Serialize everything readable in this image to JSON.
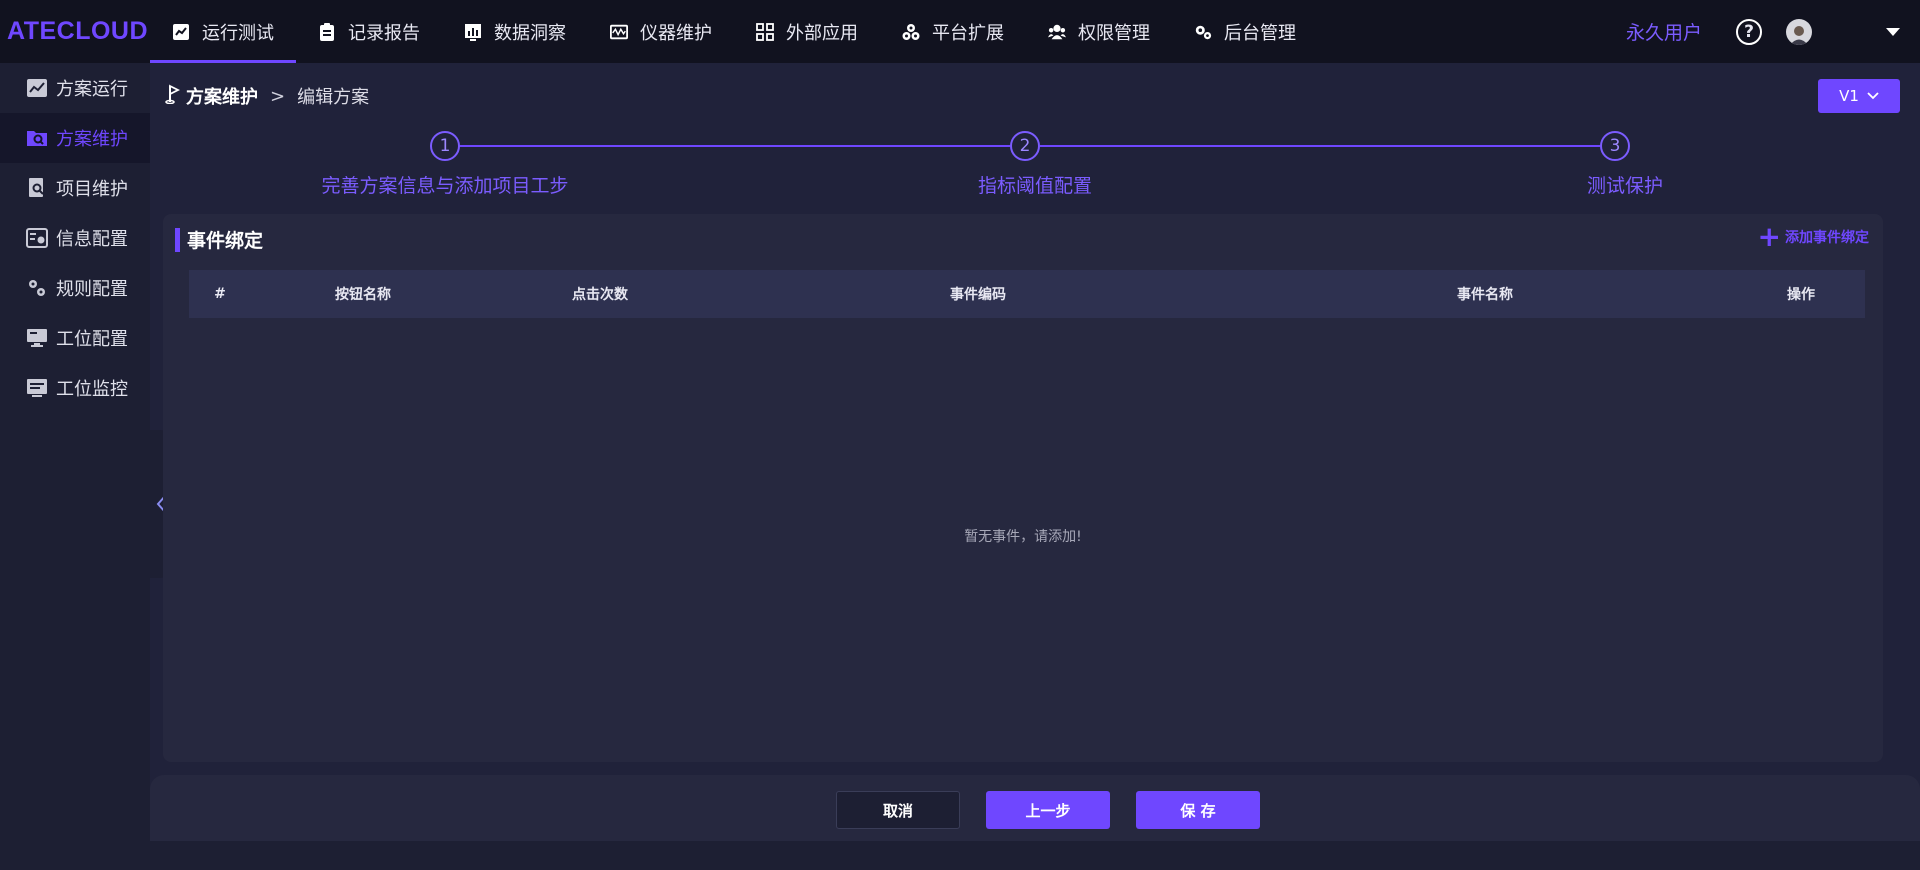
{
  "app": {
    "logo": "ATECLOUD"
  },
  "nav": {
    "items": [
      {
        "label": "运行测试",
        "icon": "chart-line-icon"
      },
      {
        "label": "记录报告",
        "icon": "clipboard-icon"
      },
      {
        "label": "数据洞察",
        "icon": "bar-chart-icon"
      },
      {
        "label": "仪器维护",
        "icon": "waveform-icon"
      },
      {
        "label": "外部应用",
        "icon": "grid-icon"
      },
      {
        "label": "平台扩展",
        "icon": "cubes-icon"
      },
      {
        "label": "权限管理",
        "icon": "users-icon"
      },
      {
        "label": "后台管理",
        "icon": "gears-icon"
      }
    ],
    "active_index": 0
  },
  "header": {
    "user_type": "永久用户",
    "help": "?",
    "username": " "
  },
  "sidebar": {
    "items": [
      {
        "label": "方案运行",
        "icon": "trend-icon"
      },
      {
        "label": "方案维护",
        "icon": "folder-search-icon"
      },
      {
        "label": "项目维护",
        "icon": "doc-search-icon"
      },
      {
        "label": "信息配置",
        "icon": "settings-panel-icon"
      },
      {
        "label": "规则配置",
        "icon": "rules-icon"
      },
      {
        "label": "工位配置",
        "icon": "monitor-icon"
      },
      {
        "label": "工位监控",
        "icon": "list-panel-icon"
      }
    ],
    "active_index": 1
  },
  "breadcrumb": {
    "root": "方案维护",
    "separator": ">",
    "current": "编辑方案"
  },
  "version": {
    "label": "V1"
  },
  "steps": [
    {
      "number": "1",
      "label": "完善方案信息与添加项目工步"
    },
    {
      "number": "2",
      "label": "指标阈值配置"
    },
    {
      "number": "3",
      "label": "测试保护"
    }
  ],
  "event_section": {
    "title": "事件绑定",
    "add_label": "添加事件绑定",
    "columns": [
      "#",
      "按钮名称",
      "点击次数",
      "事件编码",
      "事件名称",
      "操作"
    ],
    "rows": [],
    "empty_text": "暂无事件，请添加!"
  },
  "footer": {
    "cancel": "取消",
    "prev": "上一步",
    "save": "保 存"
  },
  "colors": {
    "accent": "#6f47ff",
    "background": "#20223a",
    "panel": "#26283f",
    "topbar": "#11121f"
  }
}
